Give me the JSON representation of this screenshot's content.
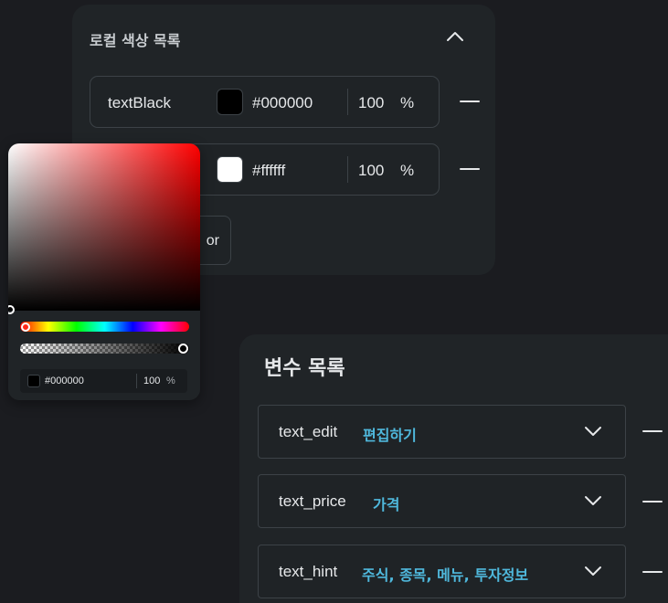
{
  "local_colors": {
    "title": "로컬 색상 목록",
    "rows": [
      {
        "name": "textBlack",
        "swatch": "#000000",
        "hex": "#000000",
        "alpha": "100",
        "unit": "%"
      },
      {
        "name": "",
        "swatch": "#ffffff",
        "hex": "#ffffff",
        "alpha": "100",
        "unit": "%"
      }
    ],
    "add_button_label": "or"
  },
  "color_picker": {
    "hue_color": "#ff0000",
    "hex": "#000000",
    "alpha": "100",
    "unit": "%"
  },
  "variables": {
    "title": "변수 목록",
    "rows": [
      {
        "name": "text_edit",
        "value": "편집하기"
      },
      {
        "name": "text_price",
        "value": "가격"
      },
      {
        "name": "text_hint",
        "value": "주식, 종목, 메뉴, 투자정보"
      }
    ]
  },
  "colors": {
    "background": "#1b1c20",
    "panel": "#202427",
    "border": "#3c4247",
    "text": "#e6e8ea",
    "accent": "#4fb8dc"
  },
  "icons": {
    "collapse": "chevron-up-icon",
    "remove": "minus-icon",
    "dropdown": "chevron-down-icon"
  }
}
